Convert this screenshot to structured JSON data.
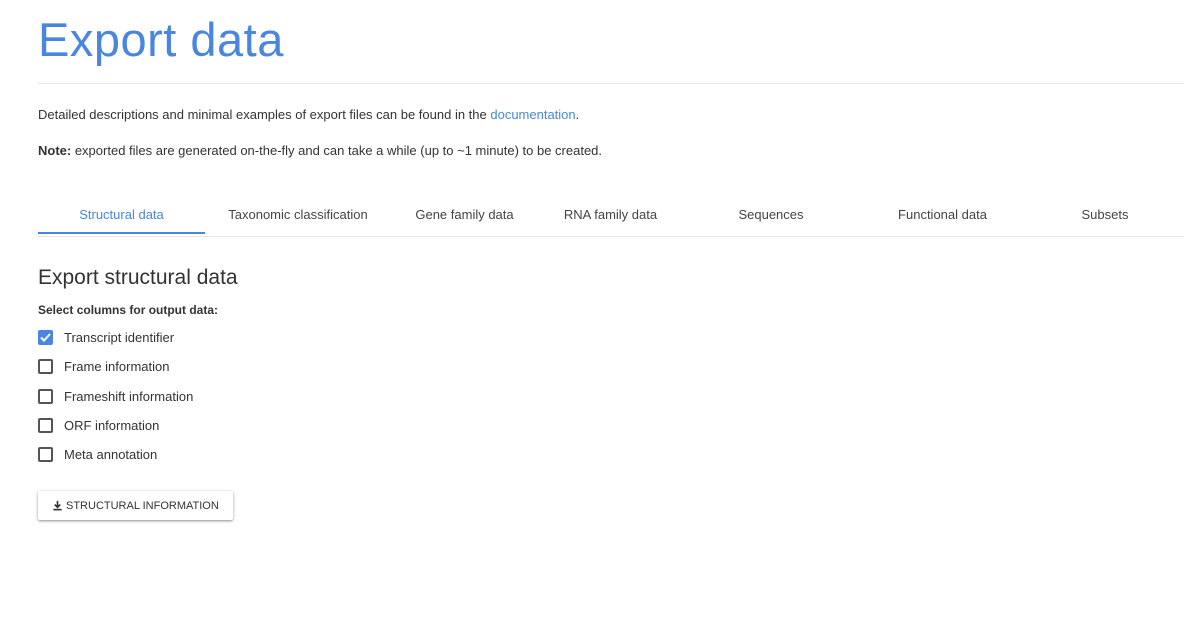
{
  "page": {
    "title": "Export data",
    "description_prefix": "Detailed descriptions and minimal examples of export files can be found in the ",
    "documentation_link": "documentation",
    "description_suffix": ".",
    "note_label": "Note:",
    "note_text": " exported files are generated on-the-fly and can take a while (up to ~1 minute) to be created."
  },
  "tabs": [
    {
      "label": "Structural data",
      "active": true
    },
    {
      "label": "Taxonomic classification",
      "active": false
    },
    {
      "label": "Gene family data",
      "active": false
    },
    {
      "label": "RNA family data",
      "active": false
    },
    {
      "label": "Sequences",
      "active": false
    },
    {
      "label": "Functional data",
      "active": false
    },
    {
      "label": "Subsets",
      "active": false
    }
  ],
  "section": {
    "title": "Export structural data",
    "select_label": "Select columns for output data:",
    "columns": [
      {
        "label": "Transcript identifier",
        "checked": true
      },
      {
        "label": "Frame information",
        "checked": false
      },
      {
        "label": "Frameshift information",
        "checked": false
      },
      {
        "label": "ORF information",
        "checked": false
      },
      {
        "label": "Meta annotation",
        "checked": false
      }
    ],
    "export_button_label": "STRUCTURAL INFORMATION"
  },
  "colors": {
    "accent": "#4a86e0",
    "text": "#333333",
    "divider": "#e6e6e6"
  },
  "icons": {
    "export_button": "download-icon",
    "checkbox_checked": "checkmark-icon"
  }
}
